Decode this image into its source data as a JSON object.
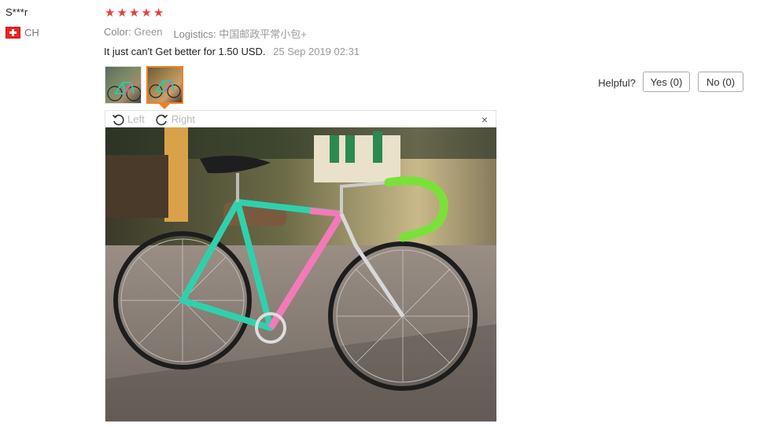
{
  "reviewer": {
    "name": "S***r",
    "country": "CH"
  },
  "rating": {
    "stars": 5,
    "star_glyph": "★",
    "color": "#e8403f"
  },
  "attributes": {
    "color_key": "Color:",
    "color_value": "Green",
    "logistics_key": "Logistics:",
    "logistics_value": "中国邮政平常小包+"
  },
  "review": {
    "text": "It just can't Get better for 1.50 USD.",
    "date": "25 Sep 2019 02:31"
  },
  "helpful": {
    "label": "Helpful?",
    "yes": "Yes (0)",
    "no": "No (0)"
  },
  "viewer": {
    "left_label": "Left",
    "right_label": "Right",
    "close_glyph": "×"
  },
  "accent_color": "#f07f2a"
}
